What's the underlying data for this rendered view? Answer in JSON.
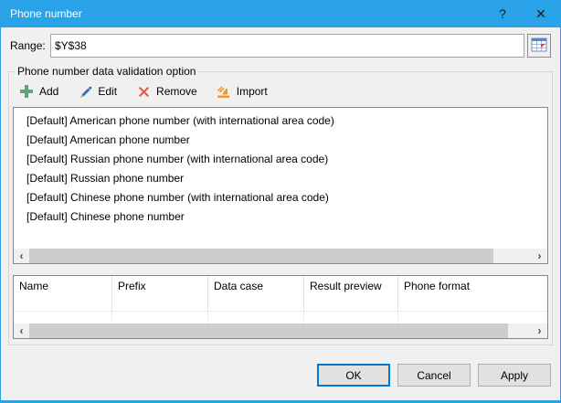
{
  "window": {
    "title": "Phone number",
    "help_glyph": "?",
    "close_glyph": "✕"
  },
  "range": {
    "label": "Range:",
    "value": "$Y$38"
  },
  "group": {
    "title": "Phone number data validation option"
  },
  "toolbar": {
    "add_label": "Add",
    "edit_label": "Edit",
    "remove_label": "Remove",
    "import_label": "Import"
  },
  "list": {
    "items": [
      "[Default] American phone number (with international area code)",
      "[Default] American phone number",
      "[Default] Russian phone number (with international area code)",
      "[Default] Russian phone number",
      "[Default] Chinese phone number (with international area code)",
      "[Default] Chinese phone number"
    ]
  },
  "table": {
    "columns": [
      "Name",
      "Prefix",
      "Data case",
      "Result preview",
      "Phone format"
    ],
    "rows": []
  },
  "scrollbar": {
    "left_glyph": "‹",
    "right_glyph": "›"
  },
  "buttons": {
    "ok": "OK",
    "cancel": "Cancel",
    "apply": "Apply"
  },
  "colors": {
    "accent": "#2aa2e8",
    "ok_focus": "#0078d7",
    "add_green": "#61a37c",
    "edit_blue": "#3c6db4",
    "remove_red": "#d9544c",
    "import_orange": "#e59b40"
  }
}
